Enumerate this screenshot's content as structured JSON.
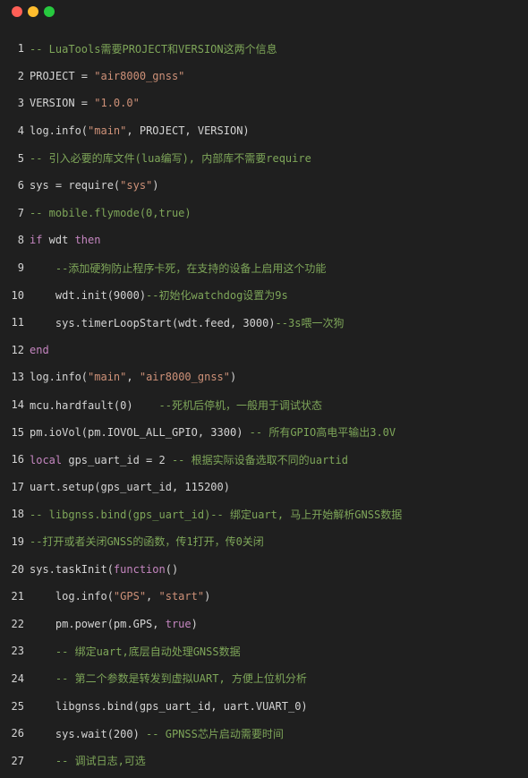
{
  "theme": {
    "background": "#1f1f1f",
    "comment": "#7ea659",
    "string": "#ce9178",
    "keyword": "#c586c0",
    "plain": "#d4d4d4"
  },
  "window_controls": [
    {
      "name": "close-button",
      "color": "#ff5f56"
    },
    {
      "name": "minimize-button",
      "color": "#ffbd2e"
    },
    {
      "name": "maximize-button",
      "color": "#27c93f"
    }
  ],
  "lines": [
    {
      "n": "1",
      "tokens": [
        [
          "comment",
          "-- LuaTools需要PROJECT和VERSION这两个信息"
        ]
      ]
    },
    {
      "n": "2",
      "tokens": [
        [
          "plain",
          "PROJECT = "
        ],
        [
          "string",
          "\"air8000_gnss\""
        ]
      ]
    },
    {
      "n": "3",
      "tokens": [
        [
          "plain",
          "VERSION = "
        ],
        [
          "string",
          "\"1.0.0\""
        ]
      ]
    },
    {
      "n": "4",
      "tokens": [
        [
          "plain",
          "log.info("
        ],
        [
          "string",
          "\"main\""
        ],
        [
          "plain",
          ", PROJECT, VERSION)"
        ]
      ]
    },
    {
      "n": "5",
      "tokens": [
        [
          "comment",
          "-- 引入必要的库文件(lua编写), 内部库不需要require"
        ]
      ]
    },
    {
      "n": "6",
      "tokens": [
        [
          "plain",
          "sys = require("
        ],
        [
          "string",
          "\"sys\""
        ],
        [
          "plain",
          ")"
        ]
      ]
    },
    {
      "n": "7",
      "tokens": [
        [
          "comment",
          "-- mobile.flymode(0,true)"
        ]
      ]
    },
    {
      "n": "8",
      "tokens": [
        [
          "keyword",
          "if"
        ],
        [
          "plain",
          " wdt "
        ],
        [
          "keyword",
          "then"
        ]
      ]
    },
    {
      "n": "9",
      "tokens": [
        [
          "plain",
          "    "
        ],
        [
          "comment",
          "--添加硬狗防止程序卡死，在支持的设备上启用这个功能"
        ]
      ]
    },
    {
      "n": "10",
      "tokens": [
        [
          "plain",
          "    wdt.init(9000)"
        ],
        [
          "comment",
          "--初始化watchdog设置为9s"
        ]
      ]
    },
    {
      "n": "11",
      "tokens": [
        [
          "plain",
          "    sys.timerLoopStart(wdt.feed, 3000)"
        ],
        [
          "comment",
          "--3s喂一次狗"
        ]
      ]
    },
    {
      "n": "12",
      "tokens": [
        [
          "keyword",
          "end"
        ]
      ]
    },
    {
      "n": "13",
      "tokens": [
        [
          "plain",
          "log.info("
        ],
        [
          "string",
          "\"main\""
        ],
        [
          "plain",
          ", "
        ],
        [
          "string",
          "\"air8000_gnss\""
        ],
        [
          "plain",
          ")"
        ]
      ]
    },
    {
      "n": "14",
      "tokens": [
        [
          "plain",
          "mcu.hardfault(0)    "
        ],
        [
          "comment",
          "--死机后停机，一般用于调试状态"
        ]
      ]
    },
    {
      "n": "15",
      "tokens": [
        [
          "plain",
          "pm.ioVol(pm.IOVOL_ALL_GPIO, 3300) "
        ],
        [
          "comment",
          "-- 所有GPIO高电平输出3.0V"
        ]
      ]
    },
    {
      "n": "16",
      "tokens": [
        [
          "keyword",
          "local"
        ],
        [
          "plain",
          " gps_uart_id = 2 "
        ],
        [
          "comment",
          "-- 根据实际设备选取不同的uartid"
        ]
      ]
    },
    {
      "n": "17",
      "tokens": [
        [
          "plain",
          "uart.setup(gps_uart_id, 115200)"
        ]
      ]
    },
    {
      "n": "18",
      "tokens": [
        [
          "comment",
          "-- libgnss.bind(gps_uart_id)-- 绑定uart, 马上开始解析GNSS数据"
        ]
      ]
    },
    {
      "n": "19",
      "tokens": [
        [
          "comment",
          "--打开或者关闭GNSS的函数，传1打开，传0关闭"
        ]
      ]
    },
    {
      "n": "20",
      "tokens": [
        [
          "plain",
          "sys.taskInit("
        ],
        [
          "keyword",
          "function"
        ],
        [
          "plain",
          "()"
        ]
      ]
    },
    {
      "n": "21",
      "tokens": [
        [
          "plain",
          "    log.info("
        ],
        [
          "string",
          "\"GPS\""
        ],
        [
          "plain",
          ", "
        ],
        [
          "string",
          "\"start\""
        ],
        [
          "plain",
          ")"
        ]
      ]
    },
    {
      "n": "22",
      "tokens": [
        [
          "plain",
          "    pm.power(pm.GPS, "
        ],
        [
          "keyword",
          "true"
        ],
        [
          "plain",
          ")"
        ]
      ]
    },
    {
      "n": "23",
      "tokens": [
        [
          "plain",
          "    "
        ],
        [
          "comment",
          "-- 绑定uart,底层自动处理GNSS数据"
        ]
      ]
    },
    {
      "n": "24",
      "tokens": [
        [
          "plain",
          "    "
        ],
        [
          "comment",
          "-- 第二个参数是转发到虚拟UART, 方便上位机分析"
        ]
      ]
    },
    {
      "n": "25",
      "tokens": [
        [
          "plain",
          "    libgnss.bind(gps_uart_id, uart.VUART_0)"
        ]
      ]
    },
    {
      "n": "26",
      "tokens": [
        [
          "plain",
          "    sys.wait(200) "
        ],
        [
          "comment",
          "-- GPNSS芯片启动需要时间"
        ]
      ]
    },
    {
      "n": "27",
      "tokens": [
        [
          "plain",
          "    "
        ],
        [
          "comment",
          "-- 调试日志,可选"
        ]
      ]
    }
  ]
}
